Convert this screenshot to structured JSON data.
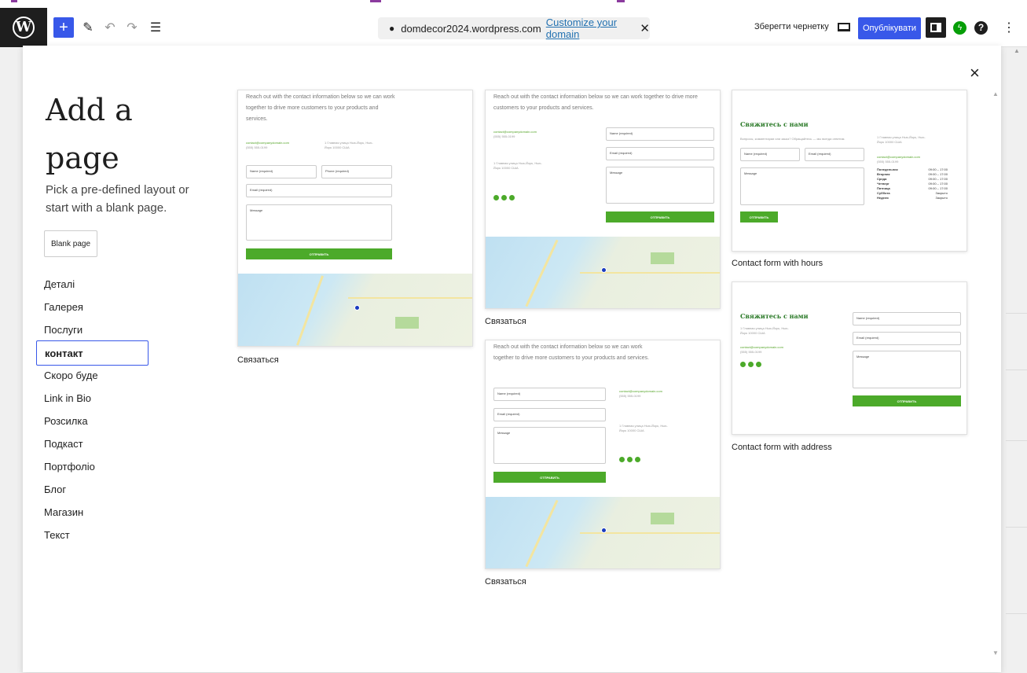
{
  "topbar": {
    "domain_url": "domdecor2024.wordpress.com",
    "customize_link": "Customize your domain",
    "save_draft": "Зберегти чернетку",
    "publish": "Опублікувати"
  },
  "modal": {
    "title": "Add a page",
    "subtitle": "Pick a pre-defined layout or start with a blank page.",
    "blank_button": "Blank page",
    "categories": [
      "Деталі",
      "Галерея",
      "Послуги",
      "контакт",
      "Скоро буде",
      "Link in Bio",
      "Розсилка",
      "Подкаст",
      "Портфоліо",
      "Блог",
      "Магазин",
      "Текст"
    ],
    "active_category": "контакт"
  },
  "patterns": [
    {
      "caption": "Связаться"
    },
    {
      "caption": "Связаться"
    },
    {
      "caption": "Связаться"
    },
    {
      "caption": "Contact form with hours"
    },
    {
      "caption": "Contact form with address"
    }
  ],
  "preview": {
    "intro_a": "Reach out with the contact information below so we can work together to drive more customers to your products and services.",
    "email": "contact@companydomain.com",
    "phone": "(555) 555-0199",
    "address": "1 Главная улица Нью-Йорк, Нью-Йорк 10000 США",
    "name_label": "Name (required)",
    "phone_label": "Phone (required)",
    "email_label": "Email (required)",
    "message_label": "Message",
    "submit": "ОТПРАВИТЬ",
    "ru_title": "Свяжитесь с нами",
    "ru_intro": "Вопросы, комментарии или заказ? Обращайтесь — мы всегда ответим.",
    "hours": [
      [
        "Понедельник",
        "09:00 – 17:00"
      ],
      [
        "Вторник",
        "09:00 – 17:00"
      ],
      [
        "Среда",
        "09:00 – 17:00"
      ],
      [
        "Четверг",
        "09:00 – 17:00"
      ],
      [
        "Пятница",
        "09:00 – 17:00"
      ],
      [
        "Суббота",
        "Закрыто"
      ],
      [
        "Неделя",
        "Закрыто"
      ]
    ]
  }
}
